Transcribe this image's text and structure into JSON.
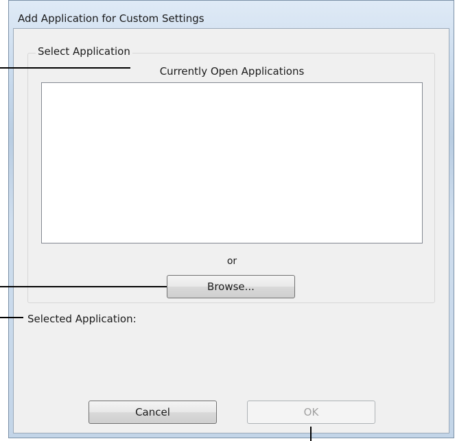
{
  "dialog": {
    "title": "Add Application for Custom Settings"
  },
  "group": {
    "label": "Select Application",
    "list_caption": "Currently Open Applications",
    "list_items": [],
    "or_text": "or",
    "browse_label": "Browse..."
  },
  "selected": {
    "label": "Selected Application:",
    "value": ""
  },
  "buttons": {
    "cancel_label": "Cancel",
    "ok_label": "OK",
    "ok_enabled": false
  }
}
